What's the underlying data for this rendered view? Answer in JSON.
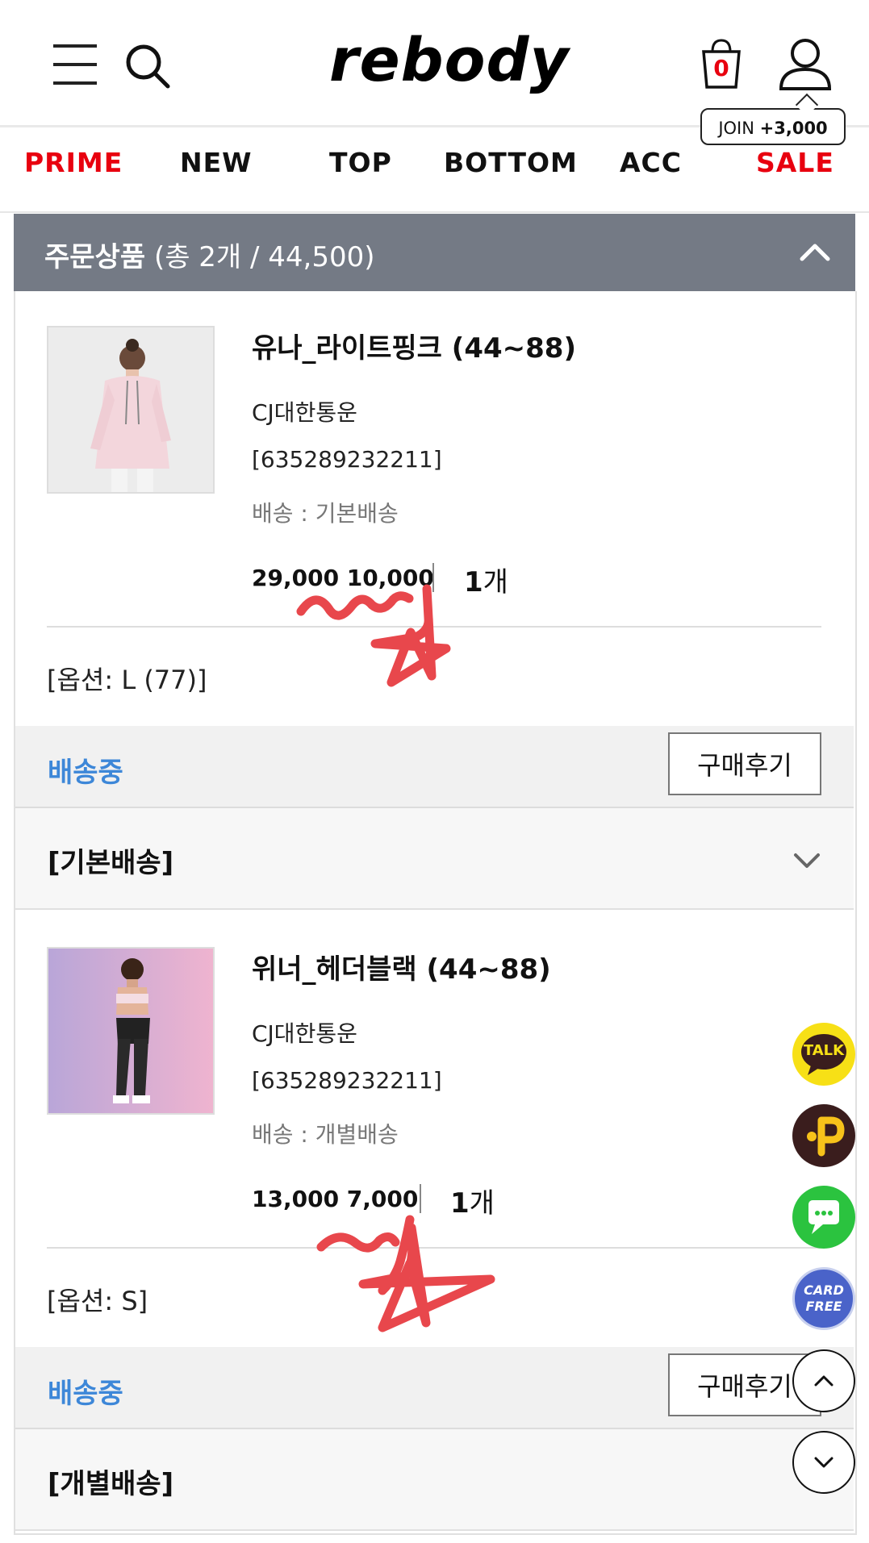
{
  "header": {
    "logo": "rebody",
    "cart_count": "0",
    "join_label": "JOIN",
    "join_points": "+3,000"
  },
  "nav": {
    "items": [
      "PRIME",
      "NEW",
      "TOP",
      "BOTTOM",
      "ACC",
      "SALE"
    ],
    "highlight_color": "#e8000f"
  },
  "order": {
    "title": "주문상품",
    "summary": "(총 2개 / 44,500)"
  },
  "products": [
    {
      "name": "유나_라이트핑크 (44~88)",
      "courier": "CJ대한통운",
      "tracking": "[635289232211]",
      "shipping": "배송 : 기본배송",
      "price": "29,000 10,000",
      "qty_num": "1",
      "qty_unit": "개",
      "option": "[옵션: L (77)]",
      "status": "배송중",
      "review_label": "구매후기",
      "ship_group": "[기본배송]"
    },
    {
      "name": "위너_헤더블랙 (44~88)",
      "courier": "CJ대한통운",
      "tracking": "[635289232211]",
      "shipping": "배송 : 개별배송",
      "price": "13,000 7,000",
      "qty_num": "1",
      "qty_unit": "개",
      "option": "[옵션: S]",
      "status": "배송중",
      "review_label": "구매후기",
      "ship_group": "[개별배송]"
    }
  ],
  "floating": {
    "talk_label": "TALK",
    "card_label_1": "CARD",
    "card_label_2": "FREE"
  },
  "colors": {
    "status_blue": "#3d87d8",
    "header_gray": "#747a85",
    "scribble_red": "#e8474c"
  }
}
